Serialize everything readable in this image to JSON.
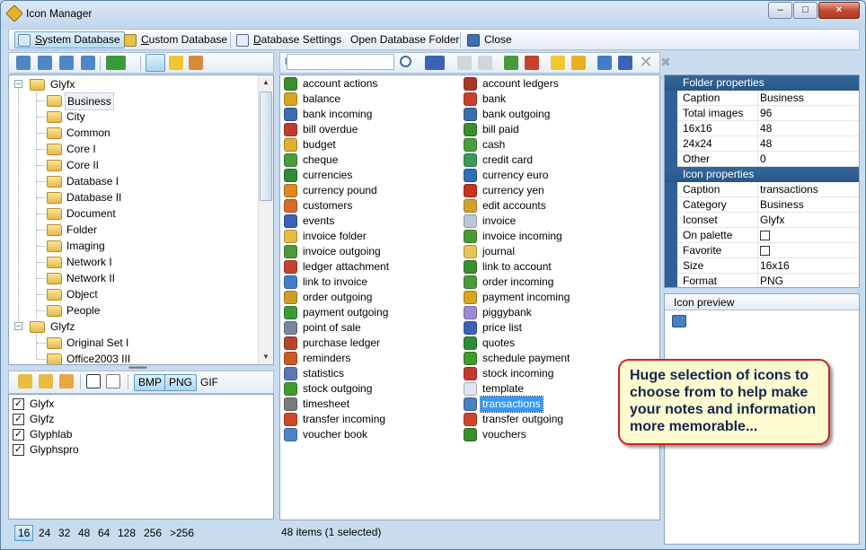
{
  "window": {
    "title": "Icon Manager",
    "min_label": "–",
    "max_label": "□",
    "close_label": "×"
  },
  "main_toolbar": {
    "system_db_u": "S",
    "system_db": "ystem Database",
    "custom_db_u": "C",
    "custom_db": "ustom Database",
    "db_settings_u": "D",
    "db_settings": "atabase Settings",
    "open_db_folder": "Open Database Folder",
    "close": "Close"
  },
  "tree": {
    "root1": "Glyfx",
    "root1_children": [
      "Business",
      "City",
      "Common",
      "Core I",
      "Core II",
      "Database I",
      "Database II",
      "Document",
      "Folder",
      "Imaging",
      "Network I",
      "Network II",
      "Object",
      "People"
    ],
    "root2": "Glyfz",
    "root2_children": [
      "Original Set I",
      "Office2003 III"
    ],
    "expander_minus": "−"
  },
  "formats": {
    "bmp": "BMP",
    "png": "PNG",
    "gif": "GIF"
  },
  "iconsets": [
    {
      "label": "Glyfx",
      "checked": "✓"
    },
    {
      "label": "Glyfz",
      "checked": "✓"
    },
    {
      "label": "Glyphlab",
      "checked": "✓"
    },
    {
      "label": "Glyphspro",
      "checked": "✓"
    }
  ],
  "sizes": [
    "16",
    "24",
    "32",
    "48",
    "64",
    "128",
    "256",
    ">256"
  ],
  "search": {
    "placeholder": ""
  },
  "icons_left": [
    {
      "label": "account actions",
      "color": "#3a8f2a"
    },
    {
      "label": "balance",
      "color": "#d9a420"
    },
    {
      "label": "bank incoming",
      "color": "#3a6fb0"
    },
    {
      "label": "bill overdue",
      "color": "#c23b2e"
    },
    {
      "label": "budget",
      "color": "#e0b030"
    },
    {
      "label": "cheque",
      "color": "#4a9a3c"
    },
    {
      "label": "currencies",
      "color": "#2f8b36"
    },
    {
      "label": "currency pound",
      "color": "#e08a1e"
    },
    {
      "label": "customers",
      "color": "#d86a28"
    },
    {
      "label": "events",
      "color": "#3b63b5"
    },
    {
      "label": "invoice folder",
      "color": "#e6be44"
    },
    {
      "label": "invoice outgoing",
      "color": "#4c9c36"
    },
    {
      "label": "ledger attachment",
      "color": "#c8402e"
    },
    {
      "label": "link to invoice",
      "color": "#3f7fc7"
    },
    {
      "label": "order outgoing",
      "color": "#d29a26"
    },
    {
      "label": "payment outgoing",
      "color": "#3d9a33"
    },
    {
      "label": "point of sale",
      "color": "#7a86a0"
    },
    {
      "label": "purchase ledger",
      "color": "#b5452d"
    },
    {
      "label": "reminders",
      "color": "#c95b22"
    },
    {
      "label": "statistics",
      "color": "#5a78b8"
    },
    {
      "label": "stock outgoing",
      "color": "#3f9b2e"
    },
    {
      "label": "timesheet",
      "color": "#7a7a7a"
    },
    {
      "label": "transfer incoming",
      "color": "#d0462a"
    },
    {
      "label": "voucher book",
      "color": "#4a86c8"
    }
  ],
  "icons_right": [
    {
      "label": "account ledgers",
      "color": "#a8372a"
    },
    {
      "label": "bank",
      "color": "#c8402e"
    },
    {
      "label": "bank outgoing",
      "color": "#3a6fb0"
    },
    {
      "label": "bill paid",
      "color": "#3a8f2a"
    },
    {
      "label": "cash",
      "color": "#4aa03a"
    },
    {
      "label": "credit card",
      "color": "#3a9a5a"
    },
    {
      "label": "currency euro",
      "color": "#2f6fb8"
    },
    {
      "label": "currency yen",
      "color": "#c8321e"
    },
    {
      "label": "edit accounts",
      "color": "#d4a12a"
    },
    {
      "label": "invoice",
      "color": "#b8c8d8"
    },
    {
      "label": "invoice incoming",
      "color": "#4a9c36"
    },
    {
      "label": "journal",
      "color": "#e2c45a"
    },
    {
      "label": "link to account",
      "color": "#3c8f2e"
    },
    {
      "label": "order incoming",
      "color": "#4a9a3c"
    },
    {
      "label": "payment incoming",
      "color": "#d9a420"
    },
    {
      "label": "piggybank",
      "color": "#9a8ad8"
    },
    {
      "label": "price list",
      "color": "#3b63b5"
    },
    {
      "label": "quotes",
      "color": "#2f8b36"
    },
    {
      "label": "schedule payment",
      "color": "#3f9b2e"
    },
    {
      "label": "stock incoming",
      "color": "#c23b2e"
    },
    {
      "label": "template",
      "color": "#dfe6ee"
    },
    {
      "label": "transactions",
      "color": "#4a7fc0"
    },
    {
      "label": "transfer outgoing",
      "color": "#d0462a"
    },
    {
      "label": "vouchers",
      "color": "#3a8f2a"
    }
  ],
  "selected_icon": "transactions",
  "status": "48 items (1 selected)",
  "folder_properties": {
    "header": "Folder properties",
    "rows": [
      {
        "k": "Caption",
        "v": "Business"
      },
      {
        "k": "Total images",
        "v": "96"
      },
      {
        "k": "16x16",
        "v": "48"
      },
      {
        "k": "24x24",
        "v": "48"
      },
      {
        "k": "Other",
        "v": "0"
      }
    ]
  },
  "icon_properties": {
    "header": "Icon properties",
    "rows": [
      {
        "k": "Caption",
        "v": "transactions"
      },
      {
        "k": "Category",
        "v": "Business"
      },
      {
        "k": "Iconset",
        "v": "Glyfx"
      },
      {
        "k": "On palette",
        "v": ""
      },
      {
        "k": "Favorite",
        "v": ""
      },
      {
        "k": "Size",
        "v": "16x16"
      },
      {
        "k": "Format",
        "v": "PNG"
      }
    ]
  },
  "preview": {
    "header": "Icon preview"
  },
  "callout": {
    "text": "Huge selection of icons to choose from to help make your notes and information more memorable..."
  },
  "colors": {
    "accent": "#3399ff",
    "header": "#2a5687",
    "callout_border": "#cc2222"
  }
}
